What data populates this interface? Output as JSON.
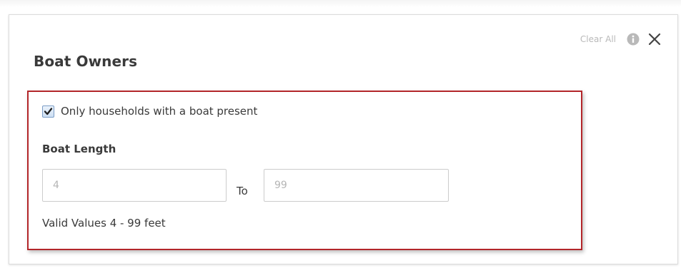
{
  "panel": {
    "title": "Boat Owners",
    "clear_all_label": "Clear All"
  },
  "icons": {
    "info": "info-circle-icon",
    "close": "close-x-icon",
    "checkbox_check": "checkmark-icon"
  },
  "filter": {
    "boat_present_label": "Only households with a boat present",
    "boat_present_checked": true,
    "length_heading": "Boat Length",
    "min_placeholder": "4",
    "max_placeholder": "99",
    "range_separator": "To",
    "valid_values_text": "Valid Values 4 - 99 feet"
  },
  "colors": {
    "highlight_border": "#b3262a",
    "muted_text": "#b9b9b9",
    "body_text": "#3a3a3a"
  }
}
